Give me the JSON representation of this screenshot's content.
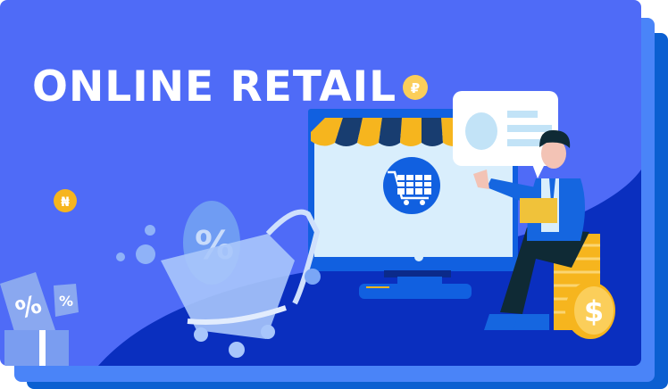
{
  "banner": {
    "title": "ONLINE RETAIL",
    "colors": {
      "background": "#4f6bf7",
      "floor": "#0a2fbf",
      "accent": "#f6b51e",
      "back_layer": "#0b5fd1",
      "middle_layer": "#4a84f8"
    }
  },
  "illustration": {
    "icons": [
      "shopping-cart-icon",
      "storefront-awning",
      "monitor",
      "person-with-laptop",
      "coin-stack",
      "dollar-coin",
      "ruble-coin",
      "naira-coin",
      "discount-tag",
      "gift-box",
      "speech-bubble"
    ],
    "coin_symbols": {
      "ruble": "₽",
      "naira": "₦",
      "dollar": "$"
    },
    "discount_symbol": "%"
  }
}
